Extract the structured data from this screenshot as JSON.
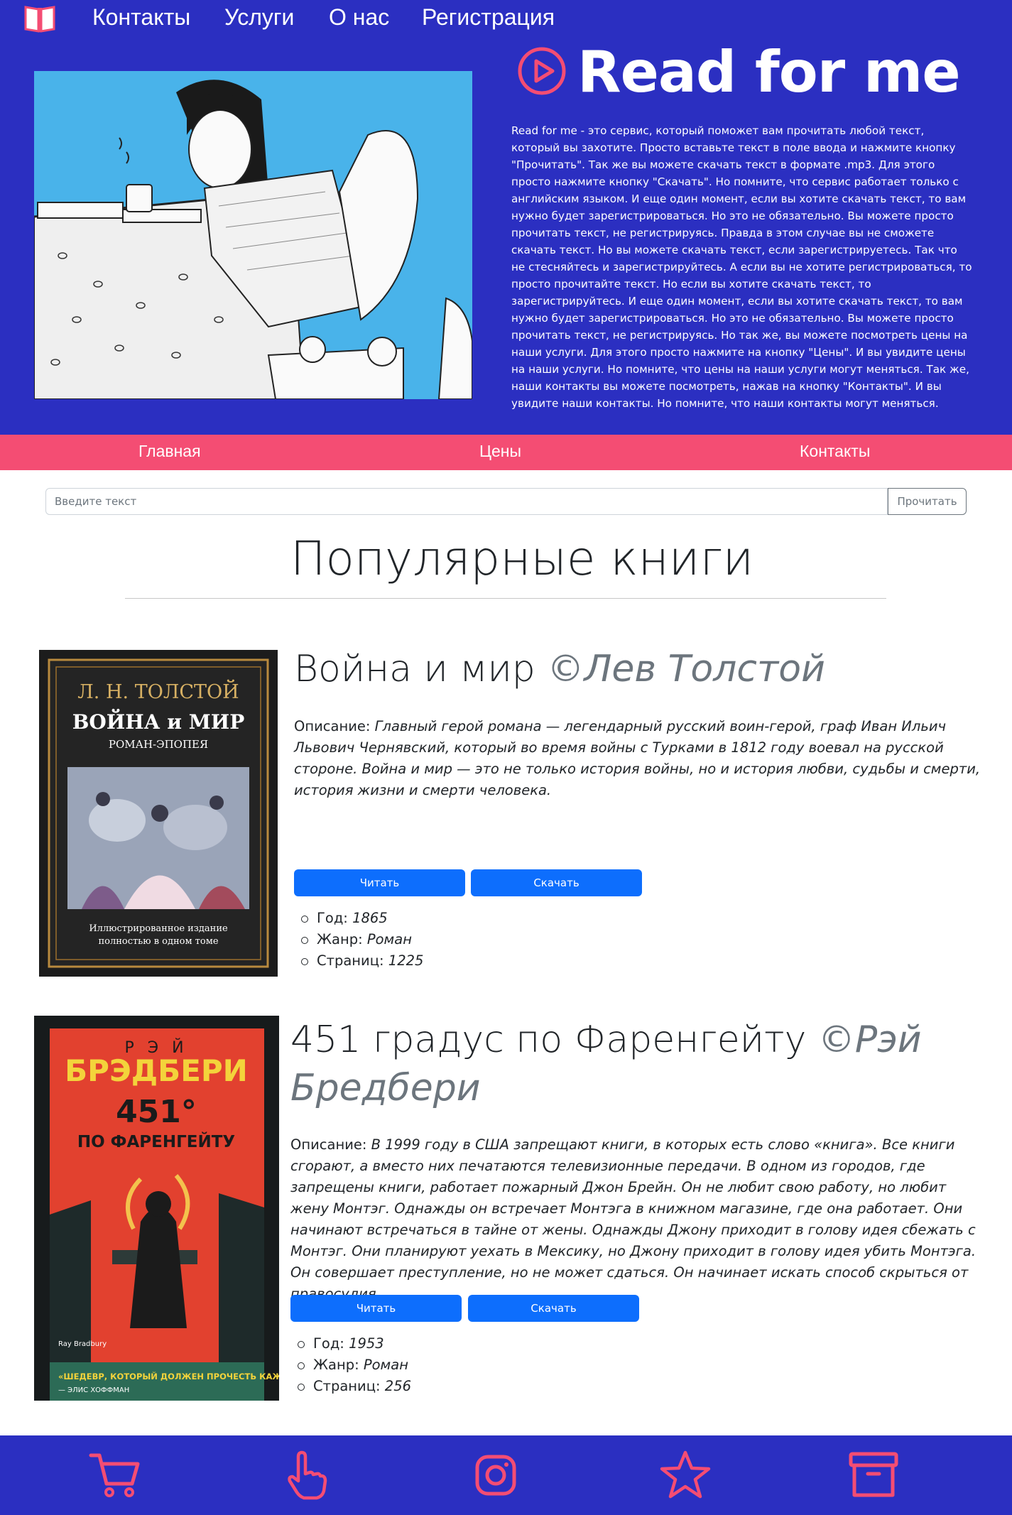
{
  "header": {
    "nav": [
      "Контакты",
      "Услуги",
      "О нас",
      "Регистрация"
    ],
    "logo_icon": "open-book-icon"
  },
  "hero": {
    "title": "Read for me",
    "title_icon": "play-circle-icon",
    "description": "Read for me - это сервис, который поможет вам прочитать любой текст, который вы захотите. Просто вставьте текст в поле ввода и нажмите кнопку \"Прочитать\". Так же вы можете скачать текст в формате .mp3. Для этого просто нажмите кнопку \"Скачать\". Но помните, что сервис работает только с английским языком. И еще один момент, если вы хотите скачать текст, то вам нужно будет зарегистрироваться. Но это не обязательно. Вы можете просто прочитать текст, не регистрируясь. Правда в этом случае вы не сможете скачать текст. Но вы можете скачать текст, если зарегистрируетесь. Так что не стесняйтесь и зарегистрируйтесь. А если вы не хотите регистрироваться, то просто прочитайте текст. Но если вы хотите скачать текст, то зарегистрируйтесь. И еще один момент, если вы хотите скачать текст, то вам нужно будет зарегистрироваться. Но это не обязательно. Вы можете просто прочитать текст, не регистрируясь. Но так же, вы можете посмотреть цены на наши услуги. Для этого просто нажмите на кнопку \"Цены\". И вы увидите цены на наши услуги. Но помните, что цены на наши услуги могут меняться. Так же, наши контакты вы можете посмотреть, нажав на кнопку \"Контакты\". И вы увидите наши контакты. Но помните, что наши контакты могут меняться."
  },
  "subnav": [
    "Главная",
    "Цены",
    "Контакты"
  ],
  "search": {
    "placeholder": "Введите текст",
    "button": "Прочитать"
  },
  "popular": {
    "heading": "Популярные книги",
    "books": [
      {
        "title": "Война и мир",
        "author": "©Лев Толстой",
        "desc_label": "Описание:",
        "description": "Главный герой романа — легендарный русский воин-герой, граф Иван Ильич Львович Чернявский, который во время войны с Турками в 1812 году воевал на русской стороне. Война и мир — это не только история войны, но и история любви, судьбы и смерти, история жизни и смерти человека.",
        "read_button": "Читать",
        "download_button": "Скачать",
        "year_label": "Год:",
        "year": "1865",
        "genre_label": "Жанр:",
        "genre": "Роман",
        "pages_label": "Страниц:",
        "pages": "1225",
        "cover": {
          "author": "Л. Н. ТОЛСТОЙ",
          "title": "ВОЙНА и МИР",
          "subtitle": "РОМАН-ЭПОПЕЯ",
          "note1": "Иллюстрированное издание",
          "note2": "полностью в одном томе"
        }
      },
      {
        "title": "451 градус по Фаренгейту",
        "author": "©Рэй Бредбери",
        "desc_label": "Описание:",
        "description": "В 1999 году в США запрещают книги, в которых есть слово «книга». Все книги сгорают, а вместо них печатаются телевизионные передачи. В одном из городов, где запрещены книги, работает пожарный Джон Брейн. Он не любит свою работу, но любит жену Монтэг. Однажды он встречает Монтэга в книжном магазине, где она работает. Они начинают встречаться в тайне от жены. Однажды Джону приходит в голову идея сбежать с Монтэг. Они планируют уехать в Мексику, но Джону приходит в голову идея убить Монтэга. Он совершает преступление, но не может сдаться. Он начинает искать способ скрыться от правосудия.",
        "read_button": "Читать",
        "download_button": "Скачать",
        "year_label": "Год:",
        "year": "1953",
        "genre_label": "Жанр:",
        "genre": "Роман",
        "pages_label": "Страниц:",
        "pages": "256",
        "cover": {
          "author_small": "Р Э Й",
          "author": "БРЭДБЕРИ",
          "title1": "451°",
          "title2": "ПО ФАРЕНГЕЙТУ",
          "signature": "Ray Bradbury",
          "quote": "«ШЕДЕВР, КОТОРЫЙ ДОЛЖЕН ПРОЧЕСТЬ КАЖДЫЙ»",
          "quote_author": "— ЭЛИС ХОФФМАН"
        }
      }
    ]
  },
  "footer": {
    "icons": [
      "cart-icon",
      "pointer-hand-icon",
      "instagram-icon",
      "star-icon",
      "archive-box-icon"
    ]
  },
  "colors": {
    "brand_blue": "#2b2fc1",
    "accent_pink": "#f44d73",
    "button_blue": "#0d6efd",
    "hero_image_bg": "#49b3ea"
  }
}
